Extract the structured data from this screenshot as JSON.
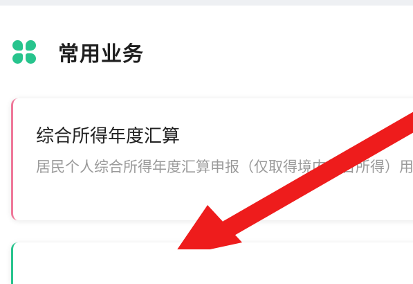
{
  "section": {
    "icon": "grid-clover-icon",
    "title": "常用业务"
  },
  "card": {
    "title": "综合所得年度汇算",
    "description": "居民个人综合所得年度汇算申报（仅取得境内综合所得）用）",
    "accent_color": "#ef7799"
  },
  "colors": {
    "icon": "#27c48d",
    "annotation_arrow": "#ee1c1c"
  }
}
